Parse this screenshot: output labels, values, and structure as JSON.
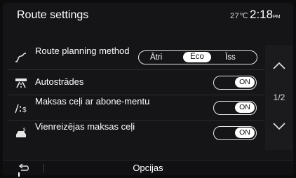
{
  "header": {
    "title": "Route settings",
    "temperature": "27℃",
    "time": "2:18",
    "time_suffix": "PM"
  },
  "settings": {
    "route_planning": {
      "label": "Route planning method",
      "options": [
        "Ātri",
        "Eco",
        "Īss"
      ],
      "selected": "Eco",
      "icon": "route-icon"
    },
    "motorways": {
      "label": "Autostrādes",
      "state": "ON",
      "icon": "motorway-icon"
    },
    "subscription_tolls": {
      "label": "Maksas ceļi ar abone-mentu",
      "state": "ON",
      "icon": "subscription-toll-icon"
    },
    "single_tolls": {
      "label": "Vienreizējas maksas ceļi",
      "state": "ON",
      "icon": "toll-icon"
    }
  },
  "pager": {
    "text": "1/2"
  },
  "bottom": {
    "options_label": "Opcijas",
    "back_icon": "back-icon"
  },
  "colors": {
    "background": "#151517",
    "text": "#ffffff",
    "toggle_on": "#ffffff"
  }
}
